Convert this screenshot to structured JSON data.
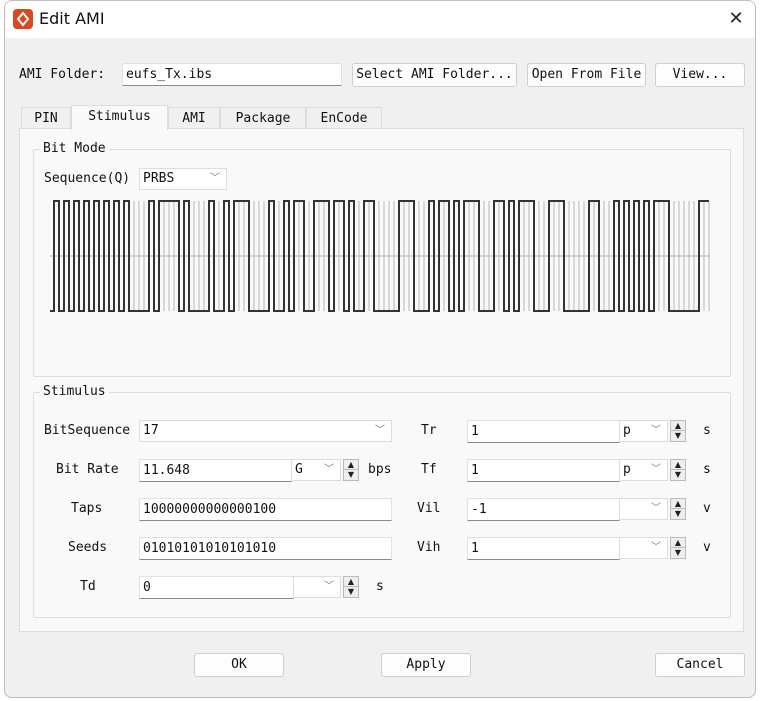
{
  "window": {
    "title": "Edit AMI",
    "icon": "app-logo-icon",
    "close_icon": "close-icon"
  },
  "folder": {
    "label": "AMI Folder:",
    "value": "eufs_Tx.ibs",
    "select_button": "Select AMI Folder...",
    "open_button": "Open From File",
    "view_button": "View..."
  },
  "tabs": [
    {
      "label": "PIN"
    },
    {
      "label": "Stimulus",
      "selected": true
    },
    {
      "label": "AMI"
    },
    {
      "label": "Package"
    },
    {
      "label": "EnCode"
    }
  ],
  "bitmode": {
    "title": "Bit Mode",
    "sequence_label": "Sequence(Q)",
    "sequence_value": "PRBS"
  },
  "chart_data": {
    "type": "line",
    "style": "step",
    "bits": "10101010101010100001011110100001001011100001001011001110110100110000011100010110101110001101011100011100000110001010101011100000011",
    "levels": [
      0,
      1
    ],
    "grid": true,
    "line_color": "#333333",
    "grid_color": "#b5b5b5"
  },
  "stimulus": {
    "title": "Stimulus",
    "bit_sequence": {
      "label": "BitSequence",
      "value": "17"
    },
    "bit_rate": {
      "label": "Bit Rate",
      "value": "11.648",
      "unit_prefix": "G",
      "unit": "bps"
    },
    "taps": {
      "label": "Taps",
      "value": "10000000000000100"
    },
    "seeds": {
      "label": "Seeds",
      "value": "01010101010101010"
    },
    "td": {
      "label": "Td",
      "value": "0",
      "unit_prefix": "",
      "unit": "s"
    },
    "tr": {
      "label": "Tr",
      "value": "1",
      "unit_prefix": "p",
      "unit": "s"
    },
    "tf": {
      "label": "Tf",
      "value": "1",
      "unit_prefix": "p",
      "unit": "s"
    },
    "vil": {
      "label": "Vil",
      "value": "-1",
      "unit_prefix": "",
      "unit": "v"
    },
    "vih": {
      "label": "Vih",
      "value": "1",
      "unit_prefix": "",
      "unit": "v"
    }
  },
  "footer": {
    "ok": "OK",
    "apply": "Apply",
    "cancel": "Cancel"
  },
  "colors": {
    "accent": "#d9481f",
    "background": "#f0f0f0",
    "pane": "#f9f9f9"
  }
}
